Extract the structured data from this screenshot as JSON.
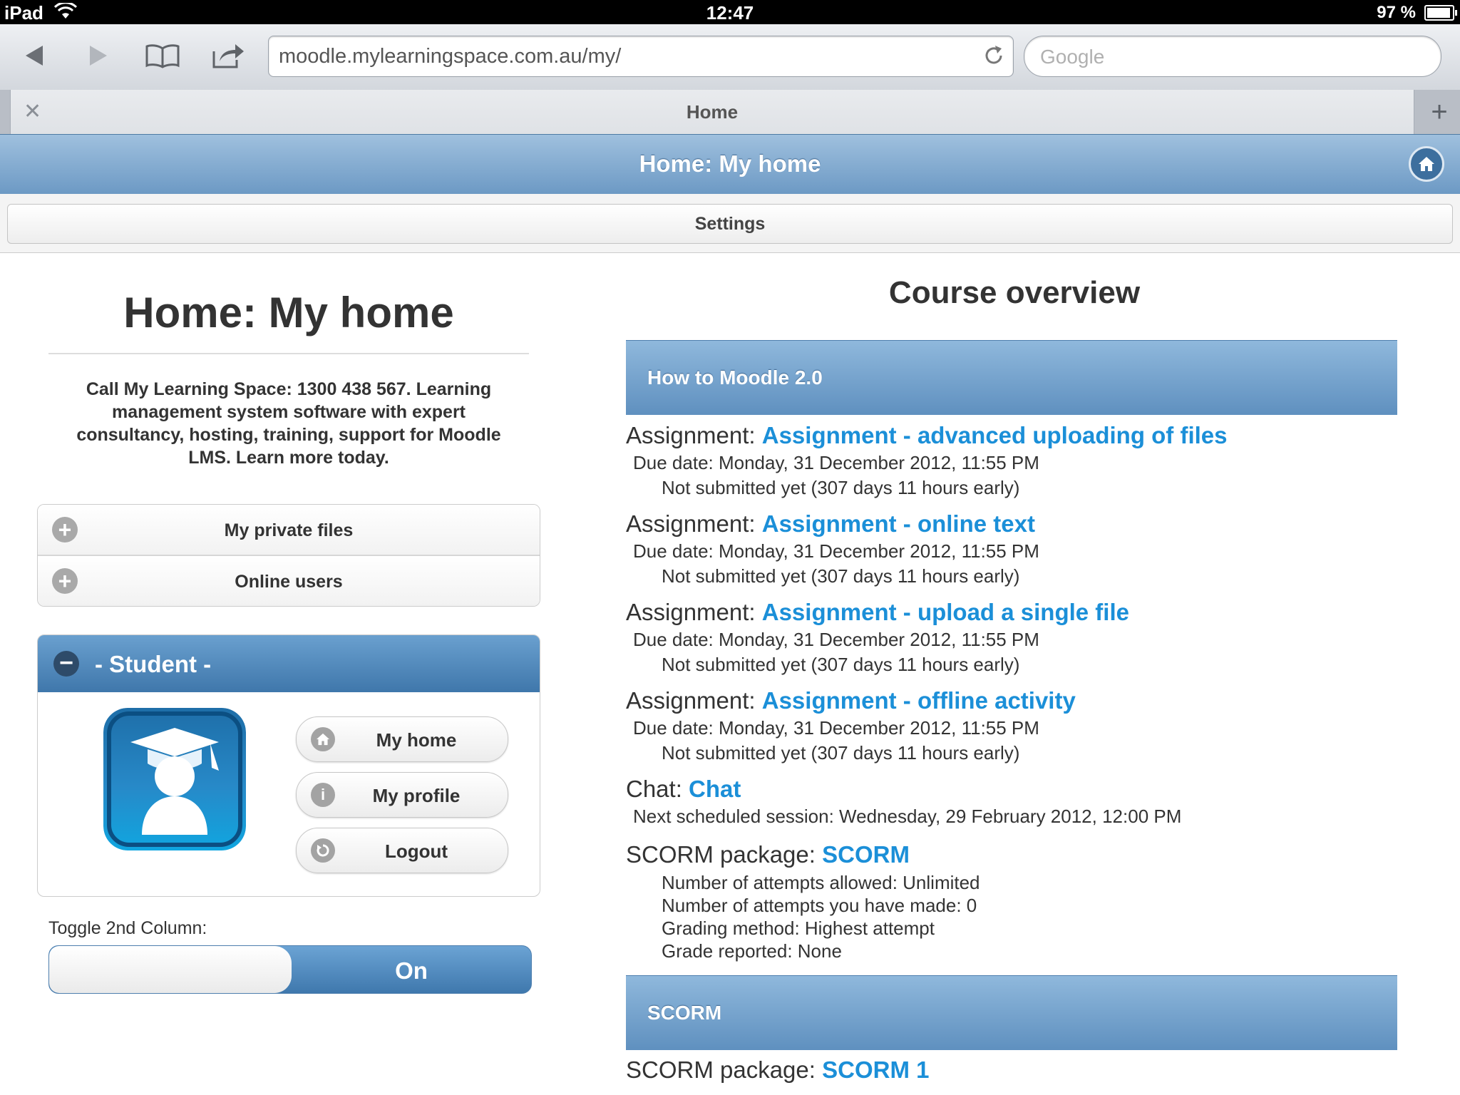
{
  "status_bar": {
    "carrier": "iPad",
    "time": "12:47",
    "battery": "97 %"
  },
  "browser": {
    "url": "moodle.mylearningspace.com.au/my/",
    "search_placeholder": "Google",
    "tab_title": "Home"
  },
  "header": {
    "title": "Home: My home"
  },
  "settings": {
    "label": "Settings"
  },
  "left": {
    "page_title": "Home: My home",
    "description": "Call My Learning Space: 1300 438 567. Learning management system software with expert consultancy, hosting, training, support for Moodle LMS. Learn more today.",
    "collapsed_blocks": [
      "My private files",
      "Online users"
    ],
    "student_block": {
      "title": "- Student -",
      "buttons": [
        "My home",
        "My profile",
        "Logout"
      ]
    },
    "toggle": {
      "label": "Toggle 2nd Column:",
      "state": "On"
    }
  },
  "overview": {
    "title": "Course overview",
    "courses": [
      {
        "name": "How to Moodle 2.0",
        "items": [
          {
            "type": "Assignment: ",
            "link": "Assignment - advanced uploading of files",
            "due": "Due date: Monday, 31 December 2012, 11:55 PM",
            "status": "Not submitted yet (307 days 11 hours early)"
          },
          {
            "type": "Assignment: ",
            "link": "Assignment - online text",
            "due": "Due date: Monday, 31 December 2012, 11:55 PM",
            "status": "Not submitted yet (307 days 11 hours early)"
          },
          {
            "type": "Assignment: ",
            "link": "Assignment - upload a single file",
            "due": "Due date: Monday, 31 December 2012, 11:55 PM",
            "status": "Not submitted yet (307 days 11 hours early)"
          },
          {
            "type": "Assignment: ",
            "link": "Assignment - offline activity",
            "due": "Due date: Monday, 31 December 2012, 11:55 PM",
            "status": "Not submitted yet (307 days 11 hours early)"
          }
        ],
        "chat": {
          "type": "Chat: ",
          "link": "Chat",
          "detail": "Next scheduled session: Wednesday, 29 February 2012, 12:00 PM"
        },
        "scorm": {
          "type": "SCORM package: ",
          "link": "SCORM",
          "details": [
            "Number of attempts allowed: Unlimited",
            "Number of attempts you have made: 0",
            "Grading method: Highest attempt",
            "Grade reported: None"
          ]
        }
      },
      {
        "name": "SCORM",
        "scorm": {
          "type": "SCORM package: ",
          "link": "SCORM 1"
        }
      }
    ]
  },
  "colors": {
    "link": "#1b8fd8",
    "header_blue": "#6c99c4",
    "block_blue": "#3f77ab"
  }
}
